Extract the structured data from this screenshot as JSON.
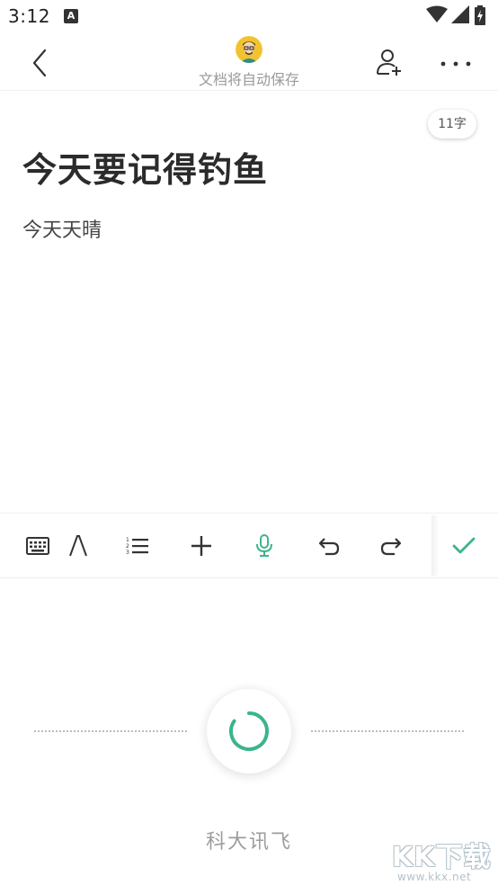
{
  "status_bar": {
    "time": "3:12",
    "app_icon_letter": "A"
  },
  "header": {
    "autosave_text": "文档将自动保存"
  },
  "document": {
    "word_count": "11字",
    "title": "今天要记得钓鱼",
    "body": "今天天晴"
  },
  "toolbar": {
    "items": [
      "keyboard",
      "text-format",
      "numbered-list",
      "insert",
      "voice-input",
      "undo",
      "redo",
      "done"
    ]
  },
  "voice": {
    "provider": "科大讯飞",
    "state": "listening"
  },
  "watermark": {
    "text": "KK下载",
    "url": "www.kkx.net"
  },
  "colors": {
    "accent": "#3bb58a",
    "text_primary": "#2b2b2b",
    "text_secondary": "#9a9a9a"
  }
}
